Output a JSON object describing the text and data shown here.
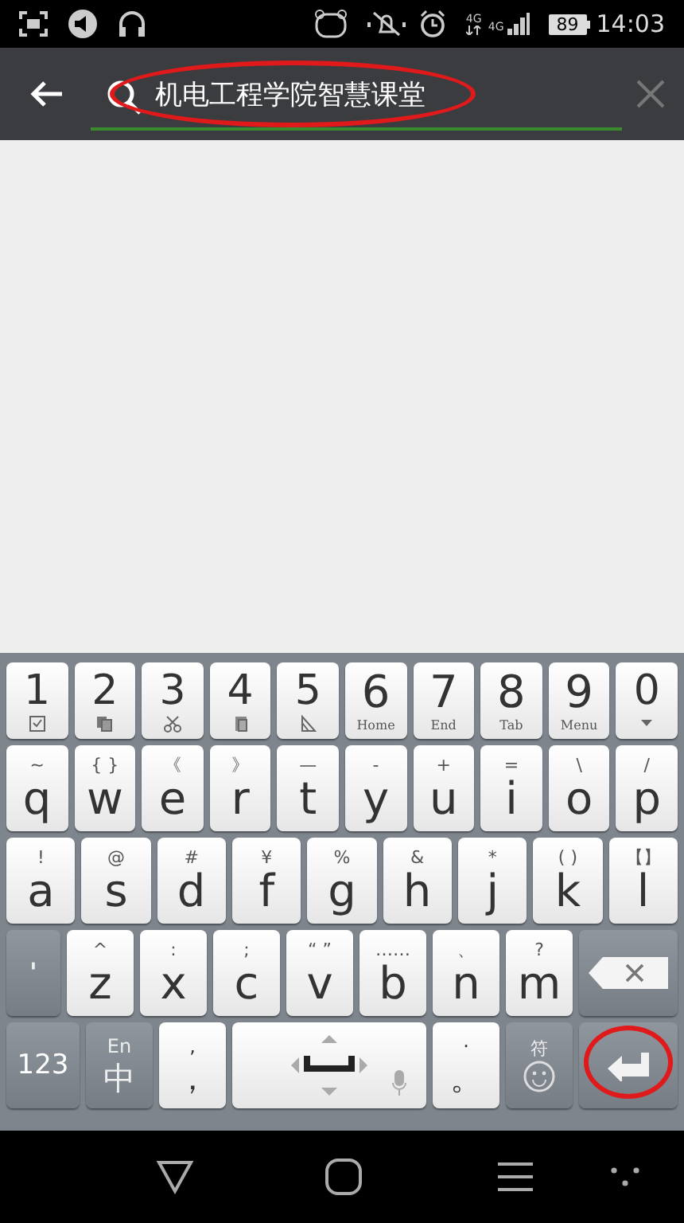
{
  "status_bar": {
    "network_top": "4G",
    "network_bottom": "4G",
    "battery": "89",
    "time": "14:03"
  },
  "search": {
    "value": "机电工程学院智慧课堂",
    "highlighted": true
  },
  "keyboard": {
    "key_rows": [
      {
        "keys": [
          {
            "kind": "letter",
            "label": "1"
          },
          {
            "kind": "letter",
            "label": "2"
          },
          {
            "kind": "letter",
            "label": "3"
          },
          {
            "kind": "letter",
            "label": "4"
          },
          {
            "kind": "letter",
            "label": "5"
          },
          {
            "kind": "letter",
            "label": "6",
            "hint": "Home"
          },
          {
            "kind": "letter",
            "label": "7",
            "hint": "End"
          },
          {
            "kind": "letter",
            "label": "8",
            "hint": "Tab"
          },
          {
            "kind": "letter",
            "label": "9",
            "hint": "Menu"
          },
          {
            "kind": "letter",
            "label": "0"
          }
        ]
      },
      {
        "keys": [
          {
            "kind": "letter",
            "label": "q",
            "hint": "~"
          },
          {
            "kind": "letter",
            "label": "w",
            "hint": "{ }"
          },
          {
            "kind": "letter",
            "label": "e",
            "hint": "《"
          },
          {
            "kind": "letter",
            "label": "r",
            "hint": "》"
          },
          {
            "kind": "letter",
            "label": "t",
            "hint": "—"
          },
          {
            "kind": "letter",
            "label": "y",
            "hint": "-"
          },
          {
            "kind": "letter",
            "label": "u",
            "hint": "+"
          },
          {
            "kind": "letter",
            "label": "i",
            "hint": "="
          },
          {
            "kind": "letter",
            "label": "o",
            "hint": "\\"
          },
          {
            "kind": "letter",
            "label": "p",
            "hint": "/"
          }
        ]
      },
      {
        "keys": [
          {
            "kind": "letter",
            "label": "a",
            "hint": "!"
          },
          {
            "kind": "letter",
            "label": "s",
            "hint": "@"
          },
          {
            "kind": "letter",
            "label": "d",
            "hint": "#"
          },
          {
            "kind": "letter",
            "label": "f",
            "hint": "¥"
          },
          {
            "kind": "letter",
            "label": "g",
            "hint": "%"
          },
          {
            "kind": "letter",
            "label": "h",
            "hint": "&"
          },
          {
            "kind": "letter",
            "label": "j",
            "hint": "*"
          },
          {
            "kind": "letter",
            "label": "k",
            "hint": "( )"
          },
          {
            "kind": "letter",
            "label": "l",
            "hint": "【】"
          }
        ]
      },
      {
        "keys": [
          {
            "kind": "apostrophe",
            "label": "'"
          },
          {
            "kind": "letter",
            "label": "z",
            "hint": "^"
          },
          {
            "kind": "letter",
            "label": "x",
            "hint": ":"
          },
          {
            "kind": "letter",
            "label": "c",
            "hint": ";"
          },
          {
            "kind": "letter",
            "label": "v",
            "hint": "“ ”"
          },
          {
            "kind": "letter",
            "label": "b",
            "hint": "……"
          },
          {
            "kind": "letter",
            "label": "n",
            "hint": "、"
          },
          {
            "kind": "letter",
            "label": "m",
            "hint": "?"
          },
          {
            "kind": "backspace"
          }
        ]
      },
      {
        "keys": [
          {
            "kind": "numbers",
            "label": "123"
          },
          {
            "kind": "language",
            "label": "中",
            "hint": "En"
          },
          {
            "kind": "punct",
            "label": "，",
            "hint": ","
          },
          {
            "kind": "space"
          },
          {
            "kind": "punct",
            "label": "。",
            "hint": "·"
          },
          {
            "kind": "symbols",
            "hint": "符"
          },
          {
            "kind": "enter",
            "highlighted": true
          }
        ]
      }
    ]
  }
}
